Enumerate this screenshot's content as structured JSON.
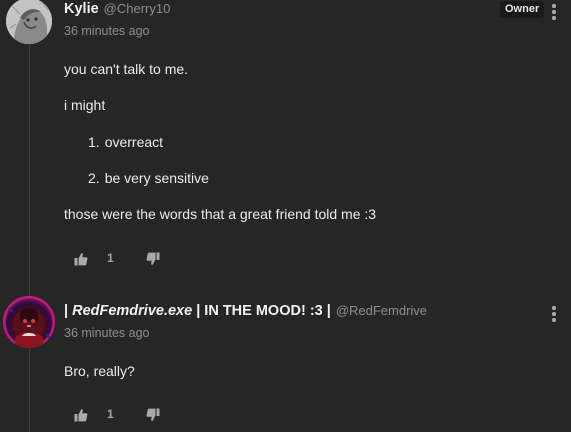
{
  "comments": [
    {
      "author": "Kylie",
      "handle": "@Cherry10",
      "time": "36 minutes ago",
      "badge": "Owner",
      "lines": {
        "p1": "you can't talk to me.",
        "p2": "i might",
        "item1_num": "1.",
        "item1_text": "overreact",
        "item2_num": "2.",
        "item2_text": "be very sensitive",
        "p3": "those were the words that a great friend told me :3"
      },
      "votes": "1"
    },
    {
      "author_prefix": "| ",
      "author_em": "RedFemdrive.exe",
      "author_suffix": " | IN THE MOOD! :3 |",
      "handle": "@RedFemdrive",
      "time": "36 minutes ago",
      "text": "Bro, really?",
      "votes": "1"
    }
  ],
  "icons": {
    "upvote": "thumbs-up-icon",
    "downvote": "thumbs-down-icon",
    "more": "kebab-menu-icon"
  },
  "colors": {
    "background": "#262626",
    "text": "#ececec",
    "muted": "#8e8e8e",
    "badge_bg": "#191919"
  }
}
